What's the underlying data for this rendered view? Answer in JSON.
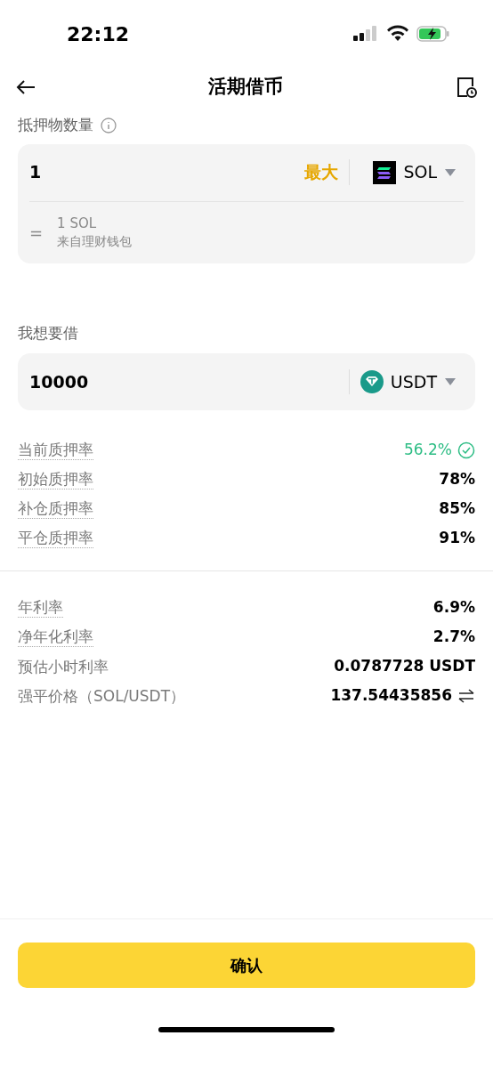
{
  "status_bar": {
    "time": "22:12"
  },
  "header": {
    "title": "活期借币"
  },
  "collateral": {
    "label": "抵押物数量",
    "value": "1",
    "max": "最大",
    "asset": "SOL",
    "equiv_sign": "=",
    "equiv": "1 SOL",
    "source": "来自理财钱包"
  },
  "borrow": {
    "label": "我想要借",
    "value": "10000",
    "asset": "USDT"
  },
  "ratios": [
    {
      "label": "当前质押率",
      "value": "56.2%",
      "dotted": true,
      "kind": "good"
    },
    {
      "label": "初始质押率",
      "value": "78%",
      "dotted": true,
      "kind": "plain"
    },
    {
      "label": "补仓质押率",
      "value": "85%",
      "dotted": true,
      "kind": "plain"
    },
    {
      "label": "平仓质押率",
      "value": "91%",
      "dotted": true,
      "kind": "plain"
    }
  ],
  "rates": [
    {
      "label": "年利率",
      "value": "6.9%",
      "dotted": true,
      "kind": "plain"
    },
    {
      "label": "净年化利率",
      "value": "2.7%",
      "dotted": true,
      "kind": "plain"
    },
    {
      "label": "预估小时利率",
      "value": "0.0787728 USDT",
      "dotted": false,
      "kind": "plain"
    },
    {
      "label": "强平价格（SOL/USDT）",
      "value": "137.54435856",
      "dotted": false,
      "kind": "swap"
    }
  ],
  "confirm_button": "确认"
}
